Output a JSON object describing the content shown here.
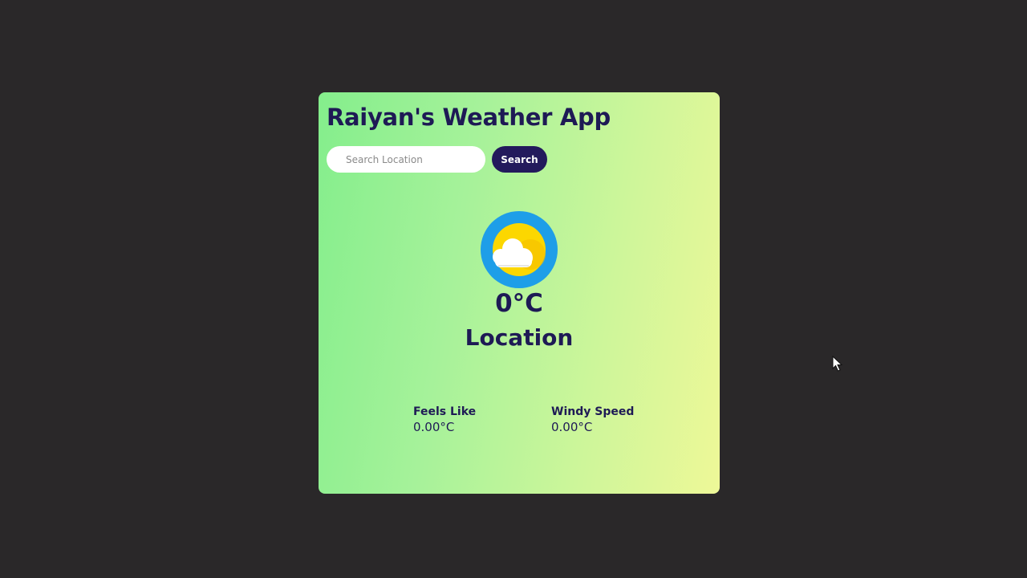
{
  "app": {
    "title": "Raiyan's Weather App"
  },
  "search": {
    "placeholder": "Search Location",
    "value": "",
    "button_label": "Search"
  },
  "current": {
    "icon": "sun-behind-cloud-icon",
    "temperature": "0°C",
    "location": "Location"
  },
  "details": [
    {
      "label": "Feels Like",
      "value": "0.00°C"
    },
    {
      "label": "Windy Speed",
      "value": "0.00°C"
    }
  ],
  "colors": {
    "background": "#2a2829",
    "gradient_start": "#84ee8c",
    "gradient_end": "#eef898",
    "text_primary": "#1e1a55",
    "button": "#231a5c",
    "icon_ring": "#1e9ee8",
    "sun": "#fcd700"
  }
}
